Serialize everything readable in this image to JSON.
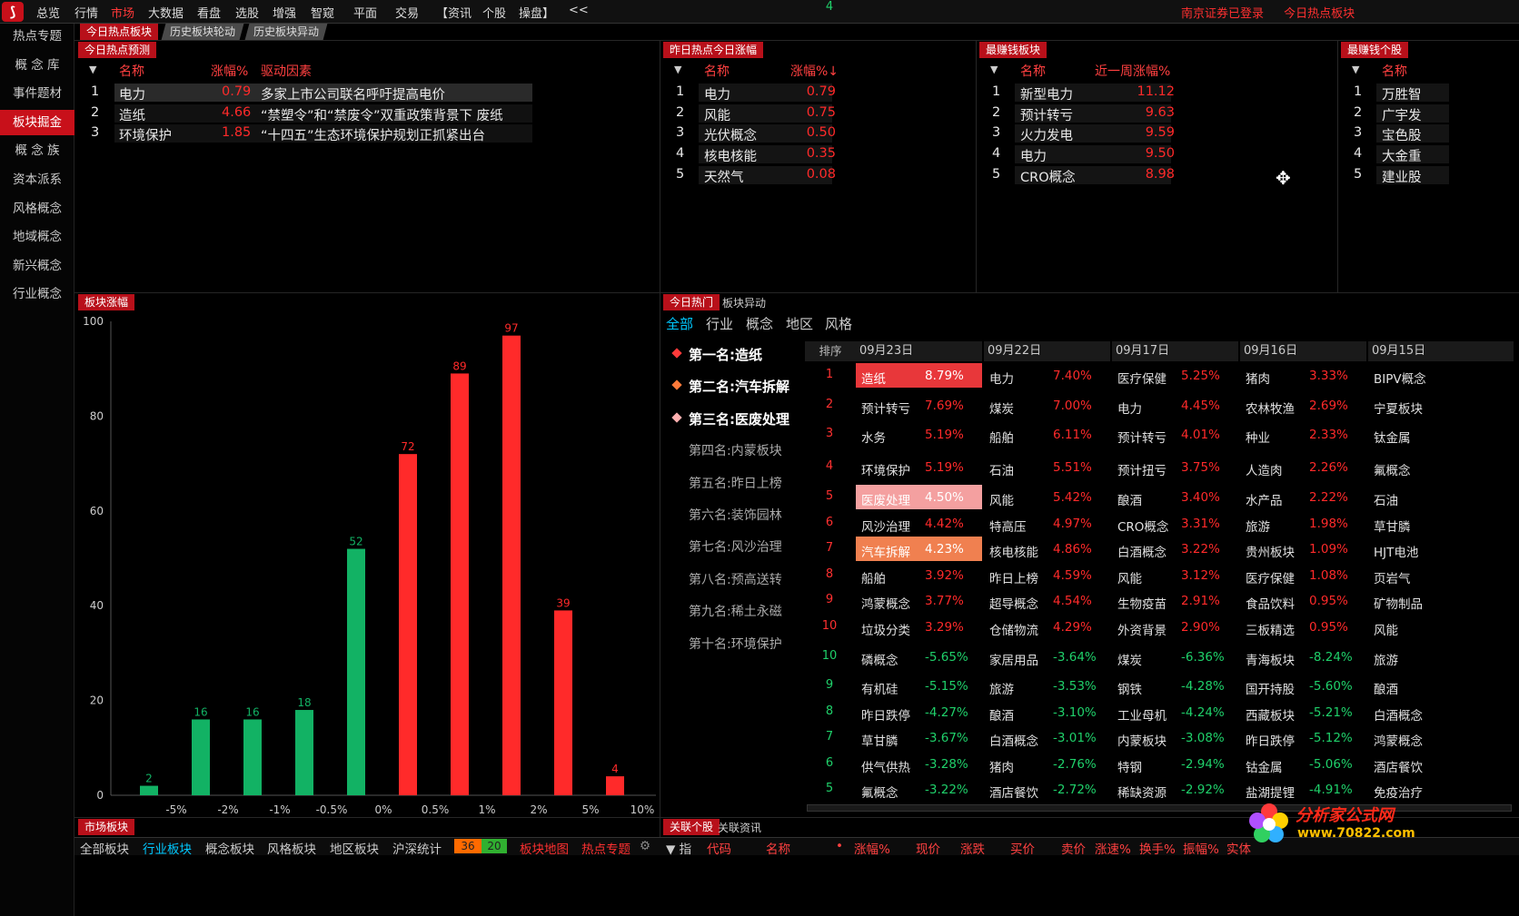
{
  "topbar": {
    "menu": [
      "总览",
      "行情",
      "市场",
      "大数据",
      "看盘",
      "选股",
      "增强",
      "智窥",
      "平面",
      "交易",
      "【资讯",
      "个股",
      "操盘】",
      "<<"
    ],
    "active_index": 2,
    "right_links": [
      "南京证券已登录",
      "今日热点板块"
    ]
  },
  "sidebar": {
    "items": [
      "热点专题",
      "概 念 库",
      "事件题材",
      "板块掘金",
      "概 念 族",
      "资本派系",
      "风格概念",
      "地域概念",
      "新兴概念",
      "行业概念"
    ],
    "active_index": 3
  },
  "tabs_top": {
    "today_hot": "今日热点板块",
    "history_rotation": "历史板块轮动",
    "history_abnormal": "历史板块异动"
  },
  "forecast_panel": {
    "title": "今日热点预测",
    "headers": {
      "name": "名称",
      "change": "涨幅%",
      "driver": "驱动因素"
    },
    "rows": [
      {
        "idx": "1",
        "name": "电力",
        "change": "0.79",
        "driver": "多家上市公司联名呼吁提高电价"
      },
      {
        "idx": "2",
        "name": "造纸",
        "change": "4.66",
        "driver": "“禁塑令”和“禁废令”双重政策背景下 废纸"
      },
      {
        "idx": "3",
        "name": "环境保护",
        "change": "1.85",
        "driver": "“十四五”生态环境保护规划正抓紧出台"
      }
    ]
  },
  "yesterday_panel": {
    "title": "昨日热点今日涨幅",
    "headers": {
      "name": "名称",
      "change": "涨幅%↓"
    },
    "rows": [
      {
        "idx": "1",
        "name": "电力",
        "change": "0.79"
      },
      {
        "idx": "2",
        "name": "风能",
        "change": "0.75"
      },
      {
        "idx": "3",
        "name": "光伏概念",
        "change": "0.50"
      },
      {
        "idx": "4",
        "name": "核电核能",
        "change": "0.35"
      },
      {
        "idx": "5",
        "name": "天然气",
        "change": "0.08"
      }
    ]
  },
  "profit_panel": {
    "title": "最赚钱板块",
    "headers": {
      "name": "名称",
      "change": "近一周涨幅%"
    },
    "rows": [
      {
        "idx": "1",
        "name": "新型电力",
        "change": "11.12"
      },
      {
        "idx": "2",
        "name": "预计转亏",
        "change": "9.63"
      },
      {
        "idx": "3",
        "name": "火力发电",
        "change": "9.59"
      },
      {
        "idx": "4",
        "name": "电力",
        "change": "9.50"
      },
      {
        "idx": "5",
        "name": "CRO概念",
        "change": "8.98"
      }
    ]
  },
  "profit_stock_panel": {
    "title": "最赚钱个股",
    "headers": {
      "name": "名称"
    },
    "rows": [
      {
        "idx": "1",
        "name": "万胜智"
      },
      {
        "idx": "2",
        "name": "广宇发"
      },
      {
        "idx": "3",
        "name": "宝色股"
      },
      {
        "idx": "4",
        "name": "大金重"
      },
      {
        "idx": "5",
        "name": "建业股"
      }
    ]
  },
  "bar_panel": {
    "title": "板块涨幅"
  },
  "chart_data": {
    "type": "bar",
    "categories": [
      "-5%",
      "-2%",
      "-1%",
      "-0.5%",
      "0%",
      "0.5%",
      "1%",
      "2%",
      "5%",
      "10%"
    ],
    "values": [
      2,
      16,
      16,
      18,
      52,
      72,
      89,
      97,
      39,
      4
    ],
    "colors": [
      "#12b264",
      "#12b264",
      "#12b264",
      "#12b264",
      "#12b264",
      "#ff2a2a",
      "#ff2a2a",
      "#ff2a2a",
      "#ff2a2a",
      "#ff2a2a"
    ],
    "yticks": [
      "0",
      "20",
      "40",
      "60",
      "80",
      "100"
    ],
    "ylim": [
      0,
      100
    ]
  },
  "hot_panel": {
    "tab_active": "今日热门",
    "tab_other": "板块异动",
    "filters": [
      "全部",
      "行业",
      "概念",
      "地区",
      "风格"
    ],
    "ranks": [
      "第一名:造纸",
      "第二名:汽车拆解",
      "第三名:医废处理",
      "第四名:内蒙板块",
      "第五名:昨日上榜",
      "第六名:装饰园林",
      "第七名:风沙治理",
      "第八名:预高送转",
      "第九名:稀土永磁",
      "第十名:环境保护"
    ],
    "rank_colors": [
      "#ff3a3a",
      "#ff7a3a",
      "#ffb0b0"
    ],
    "sort_header": "排序",
    "sort_numbers": [
      "1",
      "2",
      "3",
      "4",
      "5",
      "6",
      "7",
      "8",
      "9",
      "10",
      "10",
      "9",
      "8",
      "7",
      "6",
      "5",
      "4"
    ],
    "dates": [
      "09月23日",
      "09月22日",
      "09月17日",
      "09月16日",
      "09月15日"
    ],
    "columns": [
      [
        {
          "n": "造纸",
          "v": "8.79%",
          "bg": "#e8373a",
          "hl": true
        },
        {
          "n": "预计转亏",
          "v": "7.69%"
        },
        {
          "n": "水务",
          "v": "5.19%"
        },
        {
          "n": "环境保护",
          "v": "5.19%"
        },
        {
          "n": "医废处理",
          "v": "4.50%",
          "bg": "#f4a0a0",
          "hl": true
        },
        {
          "n": "风沙治理",
          "v": "4.42%"
        },
        {
          "n": "汽车拆解",
          "v": "4.23%",
          "bg": "#f08050",
          "hl": true
        },
        {
          "n": "船舶",
          "v": "3.92%"
        },
        {
          "n": "鸿蒙概念",
          "v": "3.77%"
        },
        {
          "n": "垃圾分类",
          "v": "3.29%"
        },
        {
          "n": "磷概念",
          "v": "-5.65%"
        },
        {
          "n": "有机硅",
          "v": "-5.15%"
        },
        {
          "n": "昨日跌停",
          "v": "-4.27%"
        },
        {
          "n": "草甘膦",
          "v": "-3.67%"
        },
        {
          "n": "供气供热",
          "v": "-3.28%"
        },
        {
          "n": "氟概念",
          "v": "-3.22%"
        }
      ],
      [
        {
          "n": "电力",
          "v": "7.40%"
        },
        {
          "n": "煤炭",
          "v": "7.00%"
        },
        {
          "n": "船舶",
          "v": "6.11%"
        },
        {
          "n": "石油",
          "v": "5.51%"
        },
        {
          "n": "风能",
          "v": "5.42%"
        },
        {
          "n": "特高压",
          "v": "4.97%"
        },
        {
          "n": "核电核能",
          "v": "4.86%"
        },
        {
          "n": "昨日上榜",
          "v": "4.59%"
        },
        {
          "n": "超导概念",
          "v": "4.54%"
        },
        {
          "n": "仓储物流",
          "v": "4.29%"
        },
        {
          "n": "家居用品",
          "v": "-3.64%"
        },
        {
          "n": "旅游",
          "v": "-3.53%"
        },
        {
          "n": "酿酒",
          "v": "-3.10%"
        },
        {
          "n": "白酒概念",
          "v": "-3.01%"
        },
        {
          "n": "猪肉",
          "v": "-2.76%"
        },
        {
          "n": "酒店餐饮",
          "v": "-2.72%"
        }
      ],
      [
        {
          "n": "医疗保健",
          "v": "5.25%"
        },
        {
          "n": "电力",
          "v": "4.45%"
        },
        {
          "n": "预计转亏",
          "v": "4.01%"
        },
        {
          "n": "预计扭亏",
          "v": "3.75%"
        },
        {
          "n": "酿酒",
          "v": "3.40%"
        },
        {
          "n": "CRO概念",
          "v": "3.31%"
        },
        {
          "n": "白酒概念",
          "v": "3.22%"
        },
        {
          "n": "风能",
          "v": "3.12%"
        },
        {
          "n": "生物疫苗",
          "v": "2.91%"
        },
        {
          "n": "外资背景",
          "v": "2.90%"
        },
        {
          "n": "煤炭",
          "v": "-6.36%"
        },
        {
          "n": "钢铁",
          "v": "-4.28%"
        },
        {
          "n": "工业母机",
          "v": "-4.24%"
        },
        {
          "n": "内蒙板块",
          "v": "-3.08%"
        },
        {
          "n": "特钢",
          "v": "-2.94%"
        },
        {
          "n": "稀缺资源",
          "v": "-2.92%"
        }
      ],
      [
        {
          "n": "猪肉",
          "v": "3.33%"
        },
        {
          "n": "农林牧渔",
          "v": "2.69%"
        },
        {
          "n": "种业",
          "v": "2.33%"
        },
        {
          "n": "人造肉",
          "v": "2.26%"
        },
        {
          "n": "水产品",
          "v": "2.22%"
        },
        {
          "n": "旅游",
          "v": "1.98%"
        },
        {
          "n": "贵州板块",
          "v": "1.09%"
        },
        {
          "n": "医疗保健",
          "v": "1.08%"
        },
        {
          "n": "食品饮料",
          "v": "0.95%"
        },
        {
          "n": "三板精选",
          "v": "0.95%"
        },
        {
          "n": "青海板块",
          "v": "-8.24%"
        },
        {
          "n": "国开持股",
          "v": "-5.60%"
        },
        {
          "n": "西藏板块",
          "v": "-5.21%"
        },
        {
          "n": "昨日跌停",
          "v": "-5.12%"
        },
        {
          "n": "钴金属",
          "v": "-5.06%"
        },
        {
          "n": "盐湖提锂",
          "v": "-4.91%"
        }
      ],
      [
        {
          "n": "BIPV概念"
        },
        {
          "n": "宁夏板块"
        },
        {
          "n": "钛金属"
        },
        {
          "n": "氟概念"
        },
        {
          "n": "石油"
        },
        {
          "n": "草甘膦"
        },
        {
          "n": "HJT电池"
        },
        {
          "n": "页岩气"
        },
        {
          "n": "矿物制品"
        },
        {
          "n": "风能"
        },
        {
          "n": "旅游"
        },
        {
          "n": "酿酒"
        },
        {
          "n": "白酒概念"
        },
        {
          "n": "鸿蒙概念"
        },
        {
          "n": "酒店餐饮"
        },
        {
          "n": "免疫治疗"
        }
      ]
    ]
  },
  "market_panel": {
    "title": "市场板块",
    "tabs": [
      "全部板块",
      "行业板块",
      "概念板块",
      "风格板块",
      "地区板块",
      "沪深统计"
    ],
    "active_index": 1,
    "badge_up": "36",
    "badge_down": "20",
    "links": [
      "板块地图",
      "热点专题"
    ]
  },
  "related_panel": {
    "tab_active": "关联个股",
    "tab_other": "关联资讯",
    "headers": [
      "▼ 指",
      "代码",
      "名称",
      "•",
      "涨幅%",
      "现价",
      "涨跌",
      "买价",
      "卖价",
      "涨速%",
      "换手%",
      "振幅%",
      "实体"
    ]
  },
  "watermark": {
    "text": "分析家公式网",
    "url": "www.70822.com"
  }
}
